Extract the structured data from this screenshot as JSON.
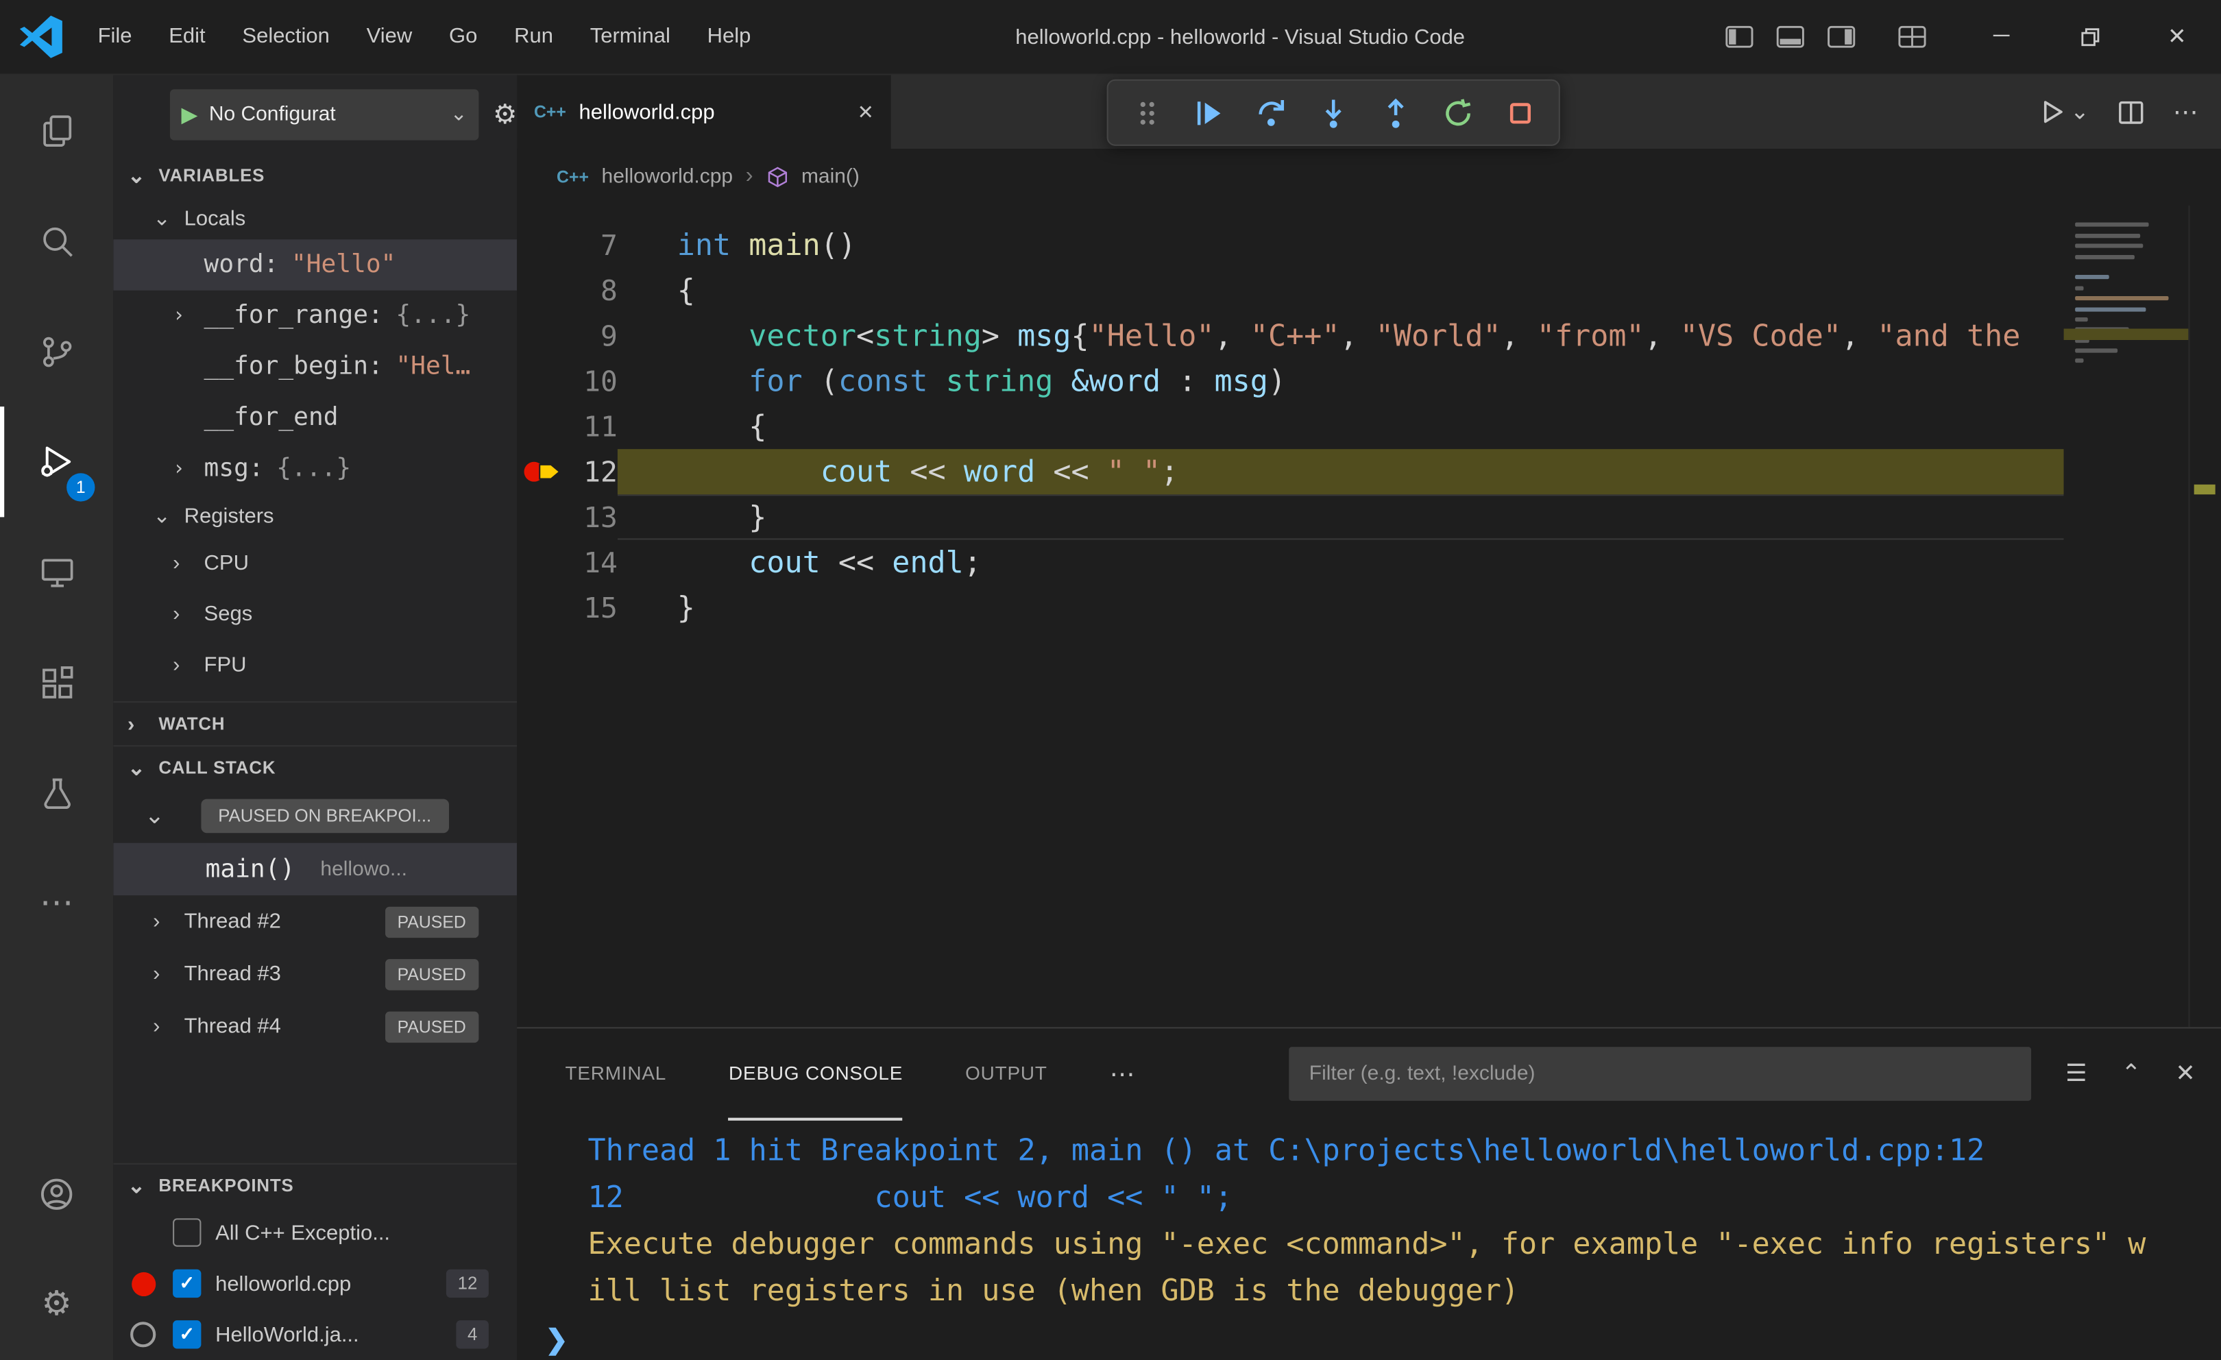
{
  "icons": {
    "chevron_down": "⌄",
    "chevron_right": "›",
    "close": "✕",
    "more": "⋯",
    "minimize": "─",
    "gear": "⚙",
    "filter_lines": "☰",
    "chevron_up": "⌃",
    "prompt": "❯",
    "breadcrumb_sep": "›",
    "cpp": "C++",
    "play": "▶"
  },
  "colors": {
    "accent_blue": "#0078d4",
    "debug_step_blue": "#75beff",
    "restart_green": "#89d185",
    "stop_red": "#f48771",
    "breakpoint_red": "#e51400",
    "current_line_highlight": "#514d1e",
    "console_info": "#3b8eea",
    "console_warn": "#d7ba6a"
  },
  "title_bar": {
    "menus": [
      "File",
      "Edit",
      "Selection",
      "View",
      "Go",
      "Run",
      "Terminal",
      "Help"
    ],
    "title": "helloworld.cpp - helloworld - Visual Studio Code"
  },
  "activity_bar": {
    "debug_badge": "1"
  },
  "debug_sidebar": {
    "config_label": "No Configurat",
    "variables": {
      "header": "VARIABLES",
      "locals_header": "Locals",
      "items": [
        {
          "name": "word:",
          "value": "\"Hello\""
        },
        {
          "name": "__for_range:",
          "value": "{...}"
        },
        {
          "name": "__for_begin:",
          "value": "\"Hel…"
        },
        {
          "name": "__for_end",
          "value": ""
        },
        {
          "name": "msg:",
          "value": "{...}"
        }
      ],
      "registers_header": "Registers",
      "registers": [
        "CPU",
        "Segs",
        "FPU"
      ]
    },
    "watch_header": "WATCH",
    "call_stack": {
      "header": "CALL STACK",
      "status_badge": "PAUSED ON BREAKPOI...",
      "frame_name": "main()",
      "frame_location": "hellowo...",
      "threads": [
        {
          "name": "Thread #2",
          "status": "PAUSED"
        },
        {
          "name": "Thread #3",
          "status": "PAUSED"
        },
        {
          "name": "Thread #4",
          "status": "PAUSED"
        }
      ]
    },
    "breakpoints": {
      "header": "BREAKPOINTS",
      "items": [
        {
          "label": "All C++ Exceptio...",
          "checked": false,
          "count": ""
        },
        {
          "label": "helloworld.cpp",
          "checked": true,
          "count": "12"
        },
        {
          "label": "HelloWorld.ja...",
          "checked": true,
          "count": "4"
        }
      ]
    }
  },
  "editor": {
    "tab_label": "helloworld.cpp",
    "breadcrumb_file": "helloworld.cpp",
    "breadcrumb_symbol": "main()",
    "code_lines": [
      {
        "num": "7",
        "tokens": [
          [
            "kw",
            "int"
          ],
          [
            "pl",
            " "
          ],
          [
            "fn",
            "main"
          ],
          [
            "pl",
            "()"
          ]
        ]
      },
      {
        "num": "8",
        "tokens": [
          [
            "pl",
            "{"
          ]
        ]
      },
      {
        "num": "9",
        "tokens": [
          [
            "pl",
            "    "
          ],
          [
            "type",
            "vector"
          ],
          [
            "pl",
            "<"
          ],
          [
            "type",
            "string"
          ],
          [
            "pl",
            "> "
          ],
          [
            "var",
            "msg"
          ],
          [
            "pl",
            "{"
          ],
          [
            "str",
            "\"Hello\""
          ],
          [
            "pl",
            ", "
          ],
          [
            "str",
            "\"C++\""
          ],
          [
            "pl",
            ", "
          ],
          [
            "str",
            "\"World\""
          ],
          [
            "pl",
            ", "
          ],
          [
            "str",
            "\"from\""
          ],
          [
            "pl",
            ", "
          ],
          [
            "str",
            "\"VS Code\""
          ],
          [
            "pl",
            ", "
          ],
          [
            "str",
            "\"and the"
          ]
        ]
      },
      {
        "num": "10",
        "tokens": [
          [
            "pl",
            "    "
          ],
          [
            "kw",
            "for"
          ],
          [
            "pl",
            " ("
          ],
          [
            "kw",
            "const"
          ],
          [
            "pl",
            " "
          ],
          [
            "type",
            "string"
          ],
          [
            "pl",
            " "
          ],
          [
            "var",
            "&word"
          ],
          [
            "pl",
            " : "
          ],
          [
            "var",
            "msg"
          ],
          [
            "pl",
            ")"
          ]
        ]
      },
      {
        "num": "11",
        "tokens": [
          [
            "pl",
            "    {"
          ]
        ]
      },
      {
        "num": "12",
        "current": true,
        "breakpoint": true,
        "tokens": [
          [
            "pl",
            "        "
          ],
          [
            "var",
            "cout"
          ],
          [
            "pl",
            " << "
          ],
          [
            "var",
            "word"
          ],
          [
            "pl",
            " << "
          ],
          [
            "str",
            "\" \""
          ],
          [
            "pl",
            ";"
          ]
        ]
      },
      {
        "num": "13",
        "cursor": true,
        "tokens": [
          [
            "pl",
            "    }"
          ]
        ]
      },
      {
        "num": "14",
        "tokens": [
          [
            "pl",
            "    "
          ],
          [
            "var",
            "cout"
          ],
          [
            "pl",
            " << "
          ],
          [
            "var",
            "endl"
          ],
          [
            "pl",
            ";"
          ]
        ]
      },
      {
        "num": "15",
        "tokens": [
          [
            "pl",
            "}"
          ]
        ]
      }
    ]
  },
  "panel": {
    "tabs": [
      "TERMINAL",
      "DEBUG CONSOLE",
      "OUTPUT"
    ],
    "active_tab": "DEBUG CONSOLE",
    "filter_placeholder": "Filter (e.g. text, !exclude)",
    "console_lines": [
      {
        "style": "info",
        "text": "Thread 1 hit Breakpoint 2, main () at C:\\projects\\helloworld\\helloworld.cpp:12"
      },
      {
        "style": "info",
        "text": "12              cout << word << \" \";"
      },
      {
        "style": "warn",
        "text": "Execute debugger commands using \"-exec <command>\", for example \"-exec info registers\" w"
      },
      {
        "style": "warn",
        "text": "ill list registers in use (when GDB is the debugger)"
      }
    ]
  }
}
